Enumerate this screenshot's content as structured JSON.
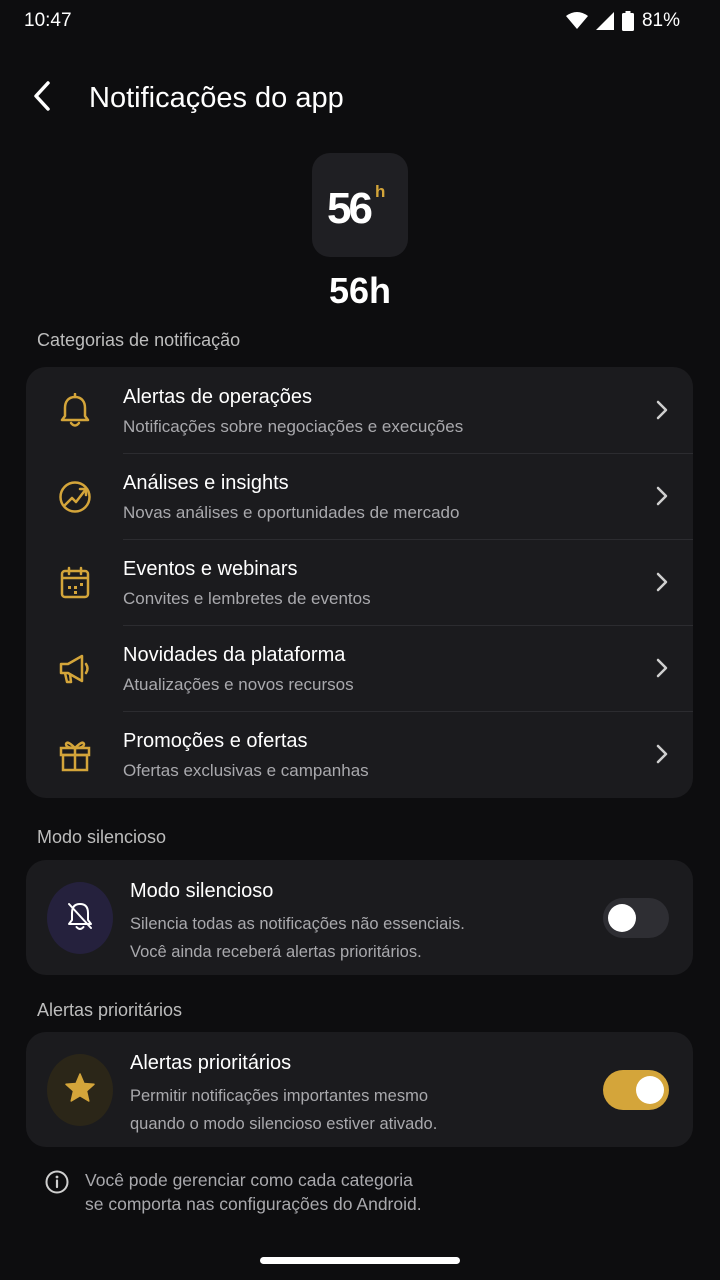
{
  "status_bar": {
    "time": "10:47",
    "battery": "81%",
    "icons": [
      "wifi-icon",
      "signal-icon",
      "battery-icon"
    ]
  },
  "header": {
    "title": "Notificações do app",
    "back_icon": "back-arrow-icon"
  },
  "app": {
    "name": "56h",
    "icon_text_main": "56",
    "icon_text_sup": "h"
  },
  "categories": {
    "section_label": "Categorias de notificação",
    "items": [
      {
        "icon": "bell-icon",
        "title": "Alertas de operações",
        "subtitle": "Notificações sobre negociações e execuções"
      },
      {
        "icon": "trend-icon",
        "title": "Análises e insights",
        "subtitle": "Novas análises e oportunidades de mercado"
      },
      {
        "icon": "calendar-icon",
        "title": "Eventos e webinars",
        "subtitle": "Convites e lembretes de eventos"
      },
      {
        "icon": "megaphone-icon",
        "title": "Novidades da plataforma",
        "subtitle": "Atualizações e novos recursos"
      },
      {
        "icon": "gift-icon",
        "title": "Promoções e ofertas",
        "subtitle": "Ofertas exclusivas e campanhas"
      }
    ]
  },
  "silent_mode": {
    "section_label": "Modo silencioso",
    "title": "Modo silencioso",
    "desc_line1": "Silencia todas as notificações não essenciais.",
    "desc_line2": "Você ainda receberá alertas prioritários.",
    "enabled": false
  },
  "priority_alerts": {
    "section_label": "Alertas prioritários",
    "title": "Alertas prioritários",
    "desc_line1": "Permitir notificações importantes mesmo",
    "desc_line2": "quando o modo silencioso estiver ativado.",
    "enabled": true
  },
  "info": {
    "line1": "Você pode gerenciar como cada categoria",
    "line2": "se comporta nas configurações do Android."
  },
  "colors": {
    "accent": "#d4a53a",
    "background": "#0d0d0f",
    "card": "#1b1b1e",
    "silent_icon_bg": "#25213d",
    "priority_icon_bg": "#2b2618"
  }
}
